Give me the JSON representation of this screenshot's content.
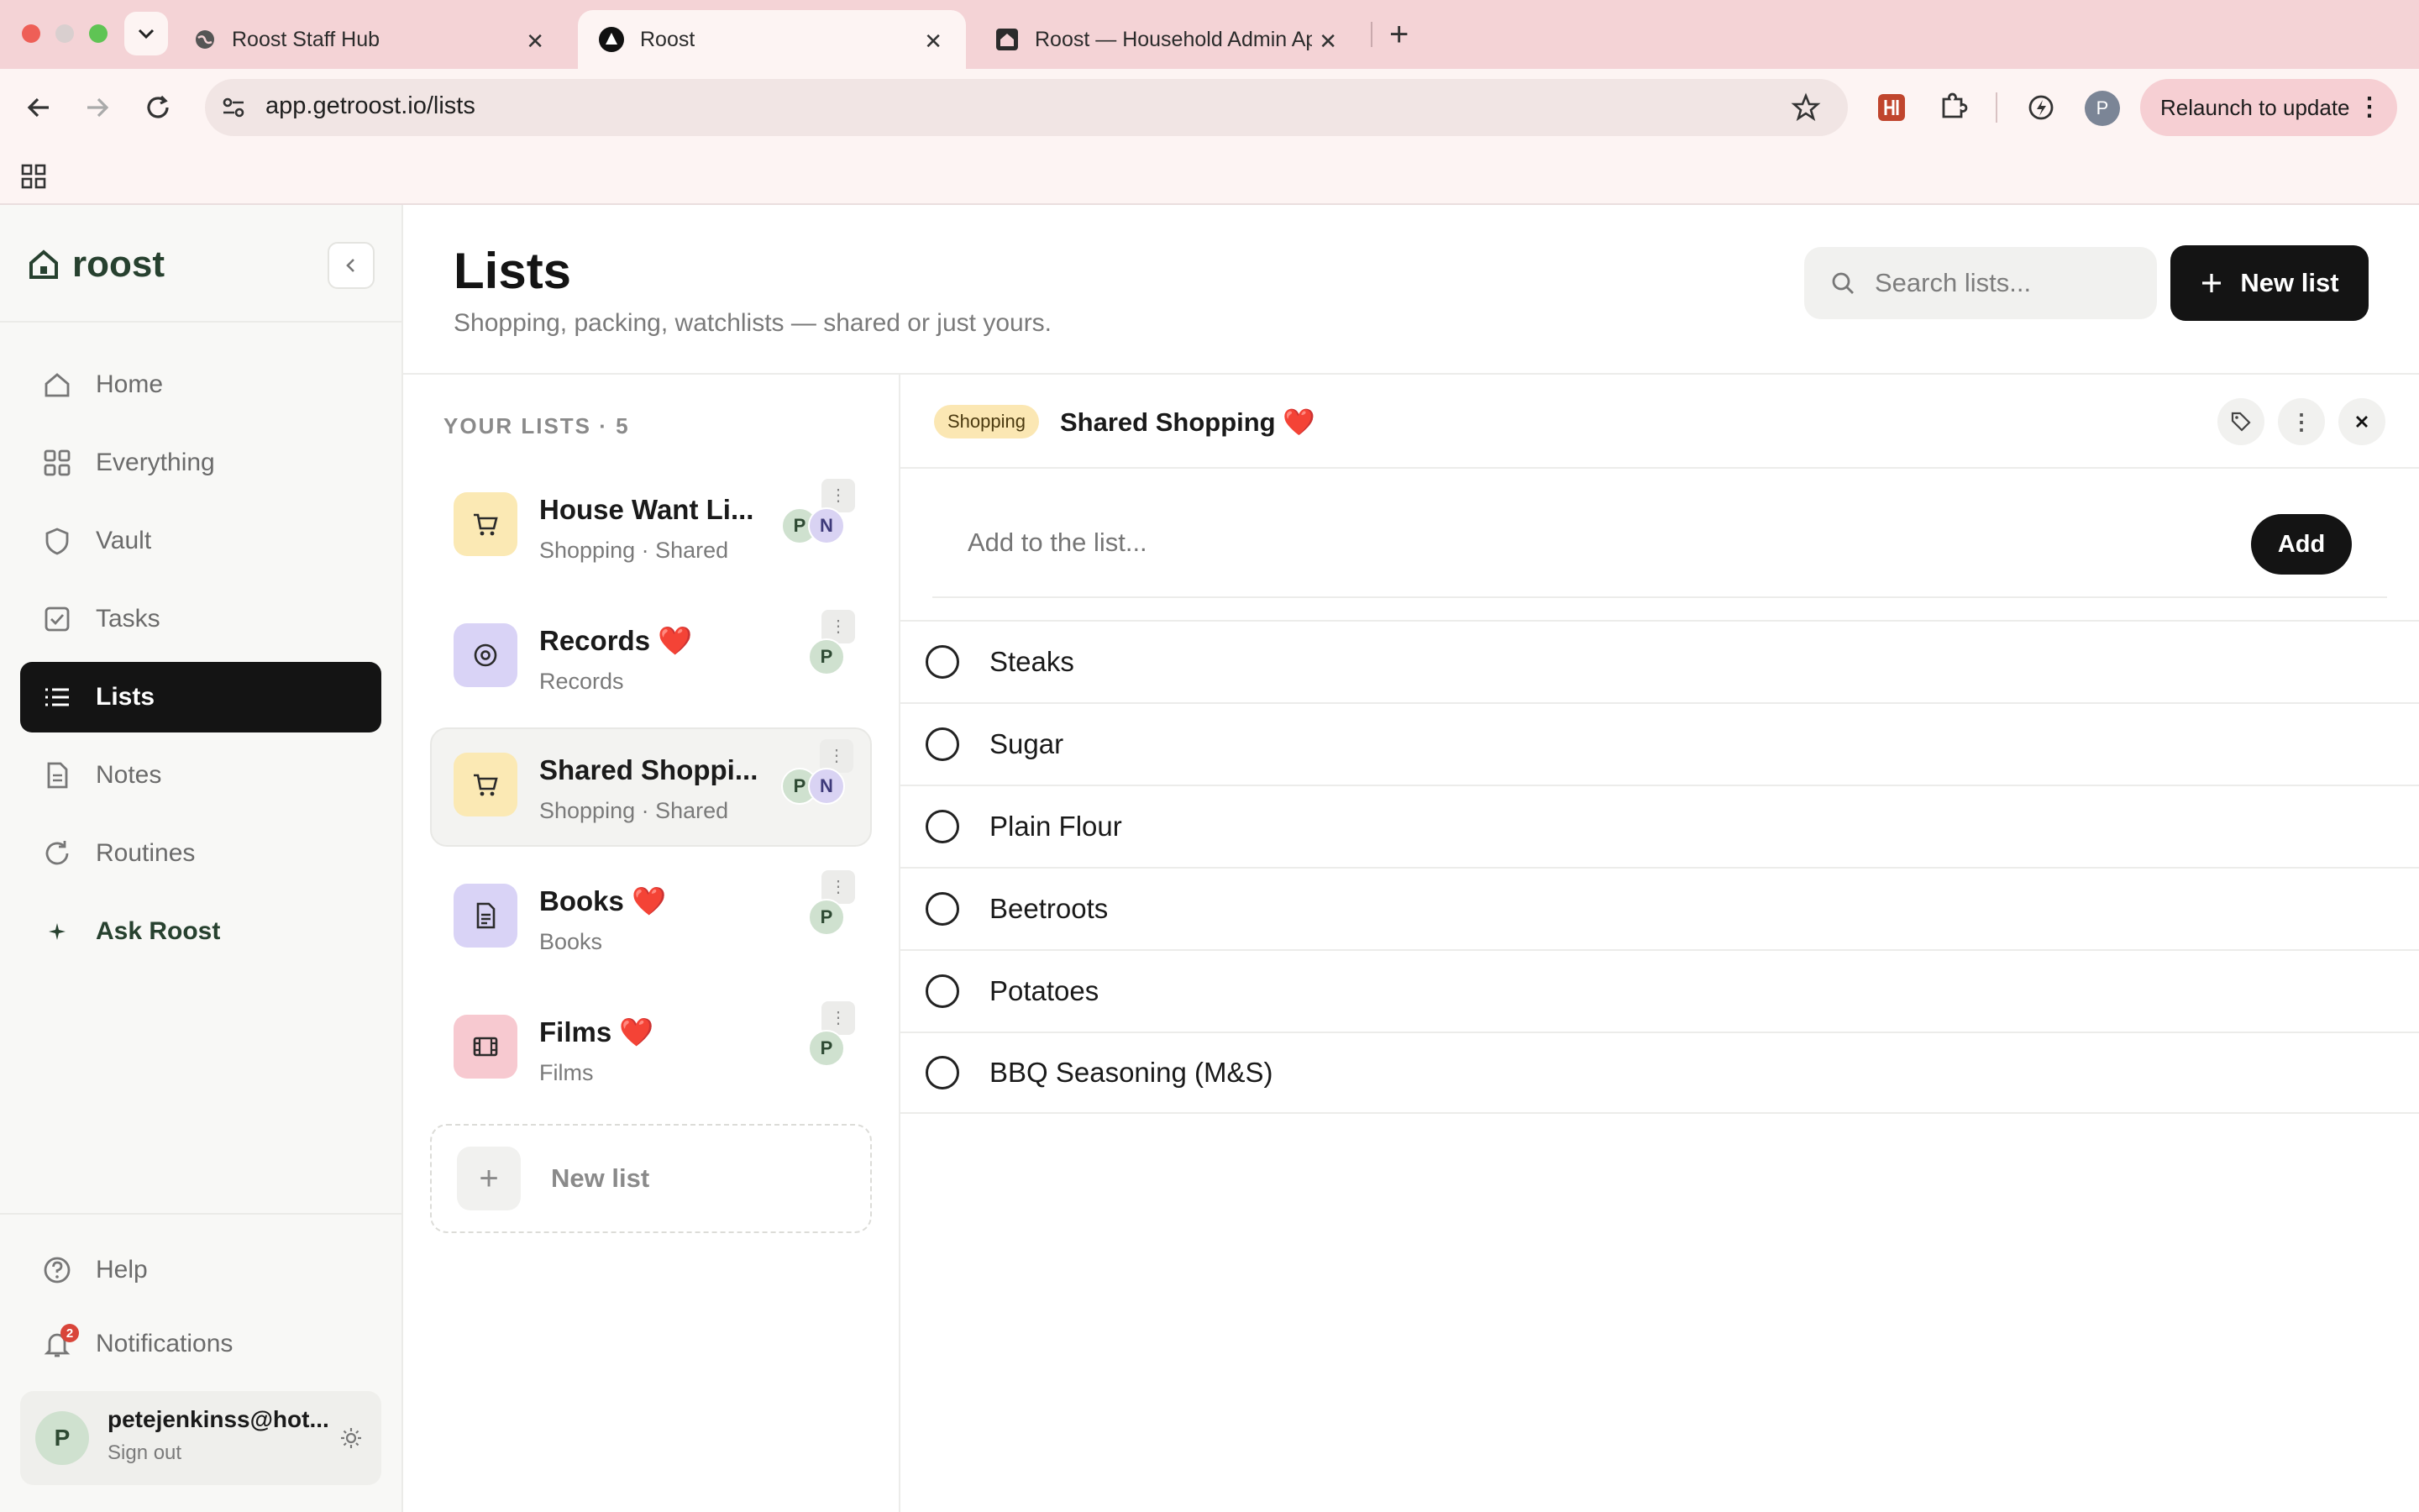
{
  "browser": {
    "tabs": [
      {
        "label": "Roost Staff Hub"
      },
      {
        "label": "Roost"
      },
      {
        "label": "Roost — Household Admin Ap"
      }
    ],
    "url": "app.getroost.io/lists",
    "relaunch_label": "Relaunch to update",
    "profile_initial": "P"
  },
  "sidebar": {
    "brand": "roost",
    "nav": [
      {
        "label": "Home"
      },
      {
        "label": "Everything"
      },
      {
        "label": "Vault"
      },
      {
        "label": "Tasks"
      },
      {
        "label": "Lists"
      },
      {
        "label": "Notes"
      },
      {
        "label": "Routines"
      },
      {
        "label": "Ask Roost"
      }
    ],
    "help_label": "Help",
    "notifications_label": "Notifications",
    "notification_count": "2",
    "user": {
      "initial": "P",
      "email": "petejenkinss@hot...",
      "signout": "Sign out"
    }
  },
  "header": {
    "title": "Lists",
    "subtitle": "Shopping, packing, watchlists — shared or just yours.",
    "search_placeholder": "Search lists...",
    "new_list_label": "New list"
  },
  "lists": {
    "heading": "YOUR LISTS · 5",
    "items": [
      {
        "name": "House Want Li...",
        "sub": "Shopping · Shared",
        "members": [
          "P",
          "N"
        ],
        "icon": "cart-icon",
        "color": "#fbe9b4"
      },
      {
        "name": "Records ❤️",
        "sub": "Records",
        "members": [
          "P"
        ],
        "icon": "record-icon",
        "color": "#d9d3f6"
      },
      {
        "name": "Shared Shoppi...",
        "sub": "Shopping · Shared",
        "members": [
          "P",
          "N"
        ],
        "icon": "cart-icon",
        "color": "#fbe9b4"
      },
      {
        "name": "Books ❤️",
        "sub": "Books",
        "members": [
          "P"
        ],
        "icon": "document-icon",
        "color": "#d9d3f6"
      },
      {
        "name": "Films ❤️",
        "sub": "Films",
        "members": [
          "P"
        ],
        "icon": "film-icon",
        "color": "#f7c9d0"
      }
    ],
    "new_list_label": "New list"
  },
  "detail": {
    "tag": "Shopping",
    "title": "Shared Shopping ❤️",
    "add_placeholder": "Add to the list...",
    "add_label": "Add",
    "items": [
      {
        "label": "Steaks"
      },
      {
        "label": "Sugar"
      },
      {
        "label": "Plain Flour"
      },
      {
        "label": "Beetroots"
      },
      {
        "label": "Potatoes"
      },
      {
        "label": "BBQ Seasoning (M&S)"
      }
    ]
  }
}
